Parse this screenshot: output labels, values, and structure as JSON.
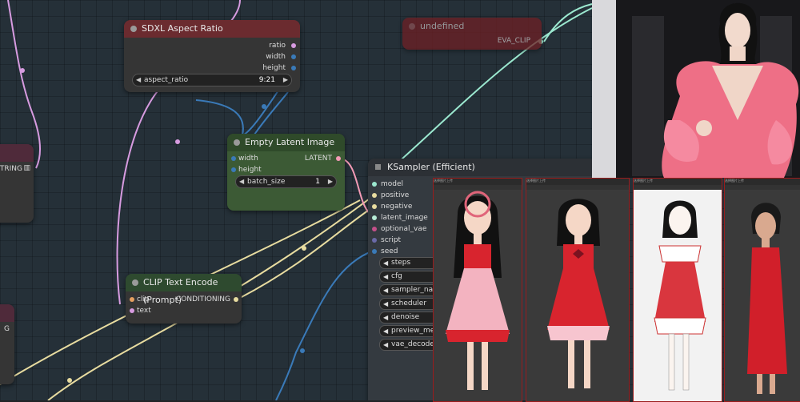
{
  "canvas": {
    "left_node_labels": [
      "STRING",
      "G"
    ],
    "nodes": {
      "aspect": {
        "title": "SDXL Aspect Ratio",
        "outputs": [
          "ratio",
          "width",
          "height"
        ],
        "widget_label": "aspect_ratio",
        "widget_value": "9:21"
      },
      "undef": {
        "title": "undefined",
        "output": "EVA_CLIP"
      },
      "latent": {
        "title": "Empty Latent Image",
        "inputs": [
          "width",
          "height"
        ],
        "output": "LATENT",
        "widget_label": "batch_size",
        "widget_value": "1"
      },
      "clip": {
        "title": "CLIP Text Encode (Prompt)",
        "inputs": [
          "clip",
          "text"
        ],
        "output": "CONDITIONING"
      },
      "ksampler": {
        "title": "KSampler (Efficient)",
        "inputs": [
          "model",
          "positive",
          "negative",
          "latent_image",
          "optional_vae",
          "script",
          "seed"
        ],
        "widgets": [
          "steps",
          "cfg",
          "sampler_name",
          "scheduler",
          "denoise",
          "preview_method",
          "vae_decode"
        ]
      }
    }
  },
  "gallery": {
    "tiles": [
      {
        "header": "选择图片上传"
      },
      {
        "header": "选择图片上传"
      },
      {
        "header": "选择图片上传"
      },
      {
        "header": "选择图片上传"
      }
    ]
  },
  "colors": {
    "canvas_bg": "#253038",
    "node_bg": "#353535",
    "aspect_title": "#6b2b2f",
    "undef_bg": "#6e1f24",
    "latent_bg": "#3c5a35",
    "clip_title": "#2e4a2f",
    "wire_clip": "#d79be0",
    "wire_cond": "#e8dca0",
    "wire_latent": "#f49bb6",
    "wire_int": "#3a7ab8",
    "wire_model": "#9be8cf"
  }
}
